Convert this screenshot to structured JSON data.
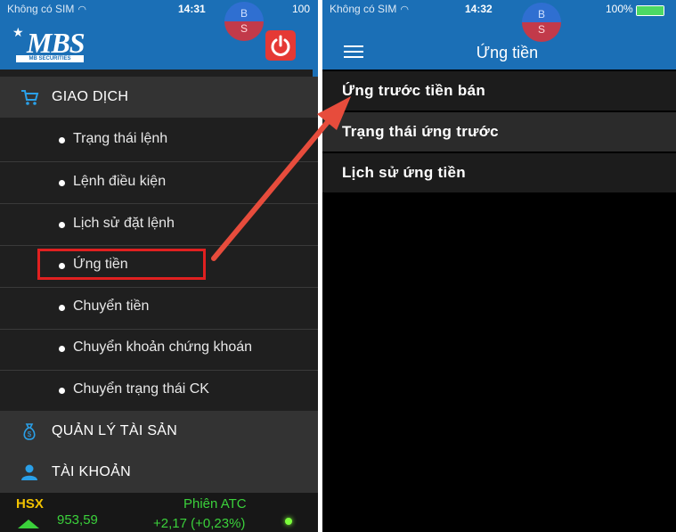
{
  "left_screen": {
    "status": {
      "carrier": "Không có SIM",
      "time": "14:31",
      "battery": "100"
    },
    "badge": {
      "top": "B",
      "bottom": "S"
    },
    "logo": {
      "text": "MBS",
      "subtitle": "MB SECURITIES"
    },
    "sections": [
      {
        "label": "GIAO DỊCH",
        "icon": "cart-icon"
      },
      {
        "label": "QUẢN LÝ TÀI SẢN",
        "icon": "money-bag-icon"
      },
      {
        "label": "TÀI KHOẢN",
        "icon": "user-icon"
      }
    ],
    "items": [
      "Trạng thái lệnh",
      "Lệnh điều kiện",
      "Lịch sử đặt lệnh",
      "Ứng tiền",
      "Chuyển tiền",
      "Chuyển khoản chứng khoán",
      "Chuyển trạng thái CK"
    ],
    "market": {
      "exchange": "HSX",
      "session": "Phiên ATC",
      "index": "953,59",
      "change": "+2,17 (+0,23%)"
    }
  },
  "right_screen": {
    "status": {
      "carrier": "Không có SIM",
      "time": "14:32",
      "battery": "100%"
    },
    "badge": {
      "top": "B",
      "bottom": "S"
    },
    "title": "Ứng tiền",
    "items": [
      "Ứng trước tiền bán",
      "Trạng thái ứng trước",
      "Lịch sử ứng tiền"
    ]
  },
  "colors": {
    "header_blue": "#1b6fb6",
    "highlight_red": "#e02020",
    "arrow_red": "#e74c3c",
    "accent_green": "#3bd13b",
    "power_red": "#e53935"
  }
}
